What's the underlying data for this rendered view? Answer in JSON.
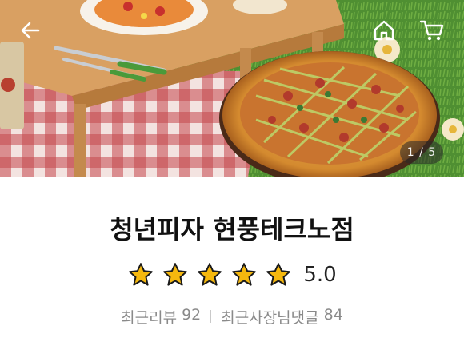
{
  "hero": {
    "image_alt_icon": "pizza-picnic-photo",
    "counter": "1 / 5"
  },
  "topbar": {
    "back_icon": "back-arrow-icon",
    "home_icon": "home-icon",
    "cart_icon": "cart-icon"
  },
  "store": {
    "name": "청년피자 현풍테크노점",
    "rating": {
      "stars": 5,
      "max": 5,
      "value_text": "5.0",
      "star_color": "#F5B80E"
    },
    "reviews": {
      "recent_label": "최근리뷰",
      "recent_count": "92",
      "owner_label": "최근사장님댓글",
      "owner_count": "84"
    }
  }
}
